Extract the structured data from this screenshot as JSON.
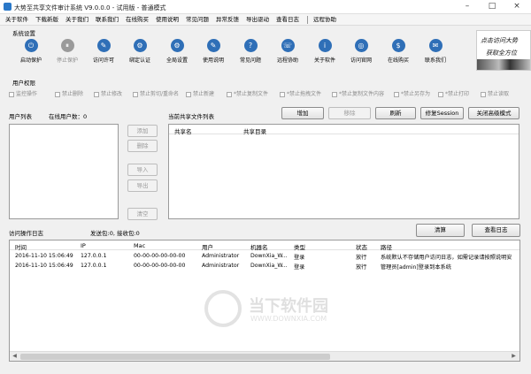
{
  "window": {
    "title": "大势至共享文件审计系统 V9.0.0.0 - 试用版 - 普通模式"
  },
  "menu": [
    "关于软件",
    "下载新版",
    "关于我们",
    "联系我们",
    "在线购买",
    "使用说明",
    "常见问题",
    "异常反馈",
    "导出驱动",
    "查看日志",
    "远程协助"
  ],
  "settings": {
    "group_label": "系统设置",
    "buttons": [
      {
        "label": "启动保护",
        "icon": "power-icon",
        "glyph": "⏻",
        "disabled": false
      },
      {
        "label": "停止保护",
        "icon": "pause-icon",
        "glyph": "⏸",
        "disabled": true
      },
      {
        "label": "访问许可",
        "icon": "key-icon",
        "glyph": "✎",
        "disabled": false
      },
      {
        "label": "绑定认证",
        "icon": "gear-icon",
        "glyph": "⚙",
        "disabled": false
      },
      {
        "label": "全局设置",
        "icon": "settings-icon",
        "glyph": "⚙",
        "disabled": false
      },
      {
        "label": "使用说明",
        "icon": "book-icon",
        "glyph": "✎",
        "disabled": false
      },
      {
        "label": "常见问题",
        "icon": "question-icon",
        "glyph": "?",
        "disabled": false
      },
      {
        "label": "远程协助",
        "icon": "remote-icon",
        "glyph": "☏",
        "disabled": false
      },
      {
        "label": "关于软件",
        "icon": "info-icon",
        "glyph": "i",
        "disabled": false
      },
      {
        "label": "访问官网",
        "icon": "globe-icon",
        "glyph": "◎",
        "disabled": false
      },
      {
        "label": "在线购买",
        "icon": "cart-icon",
        "glyph": "$",
        "disabled": false
      },
      {
        "label": "联系我们",
        "icon": "contact-icon",
        "glyph": "✉",
        "disabled": false
      }
    ]
  },
  "logo": {
    "line1": "点击访问大势",
    "line2": "获取全方位"
  },
  "permissions": {
    "group_label": "用户权限",
    "items": [
      "监控操作",
      "禁止删除",
      "禁止修改",
      "禁止剪切/重命名",
      "禁止新建",
      "*禁止复制文件",
      "*禁止拖拽文件",
      "*禁止复制文件内容",
      "*禁止另存为",
      "*禁止打印",
      "禁止读取"
    ]
  },
  "users": {
    "label": "用户列表",
    "online_label": "在线用户数：0"
  },
  "user_actions": {
    "add": "添加",
    "delete": "删除",
    "import": "导入",
    "export": "导出",
    "clear": "清空"
  },
  "shares": {
    "label": "当前共享文件列表",
    "columns": [
      "共享名",
      "共享目录"
    ],
    "buttons": {
      "add": "增加",
      "remove": "移除",
      "refresh": "刷新",
      "repair": "修复Session",
      "close_advanced": "关闭高级模式"
    }
  },
  "log": {
    "label": "访问操作日志",
    "stats": "发送包:0, 接收包:0",
    "buttons": {
      "clear": "清算",
      "view": "查看日志"
    },
    "columns": [
      "时间",
      "IP",
      "Mac",
      "用户",
      "机器名",
      "类型",
      "状态",
      "路径"
    ],
    "rows": [
      [
        "2016-11-10 15:06:49",
        "127.0.0.1",
        "00-00-00-00-00-00",
        "Administrator",
        "DownXia_W...",
        "登录",
        "放行",
        "系统默认不存储用户访问日志，如需记录请按照说明安"
      ],
      [
        "2016-11-10 15:06:49",
        "127.0.0.1",
        "00-00-00-00-00-00",
        "Administrator",
        "DownXia_W...",
        "登录",
        "放行",
        "管理员[admin]登录到本系统"
      ]
    ]
  },
  "watermark": {
    "text": "当下软件园",
    "sub": "WWW.DOWNXIA.COM"
  }
}
